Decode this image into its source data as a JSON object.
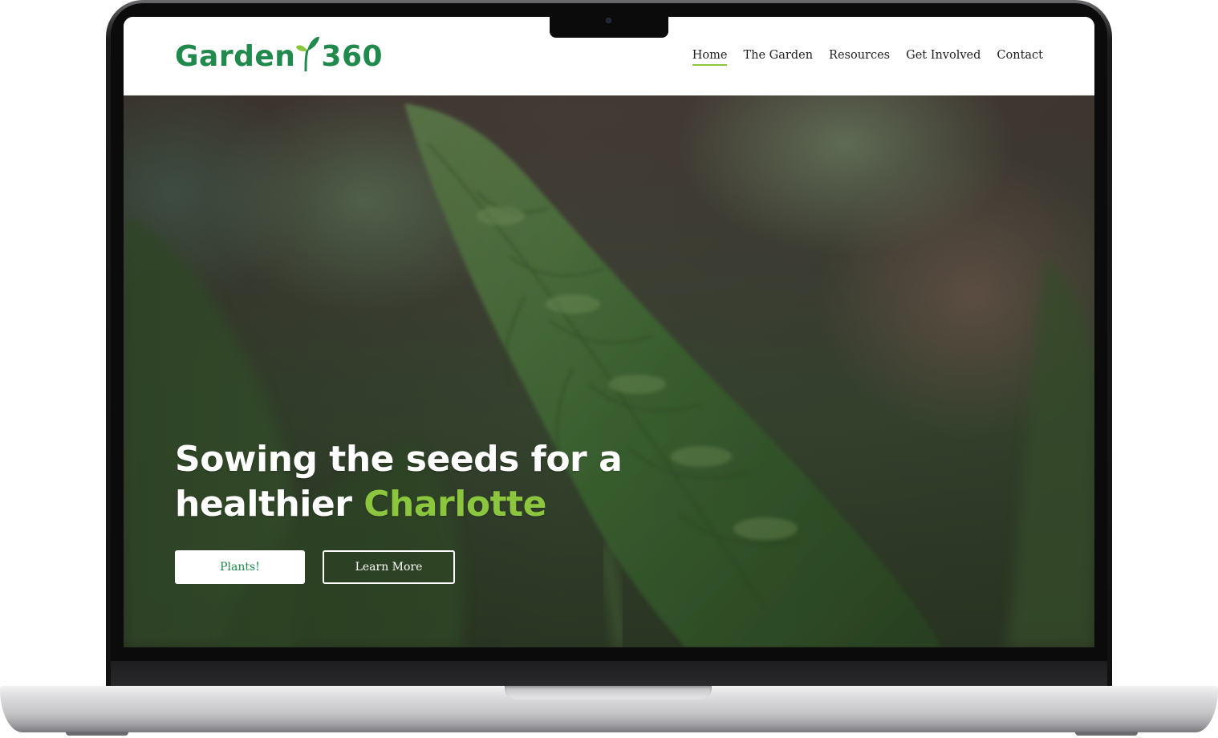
{
  "logo": {
    "text_left": "Garden",
    "text_right": "360",
    "icon": "sprout-icon",
    "color": "#1f8a4c"
  },
  "nav": {
    "items": [
      {
        "label": "Home",
        "active": true
      },
      {
        "label": "The Garden",
        "active": false
      },
      {
        "label": "Resources",
        "active": false
      },
      {
        "label": "Get Involved",
        "active": false
      },
      {
        "label": "Contact",
        "active": false
      }
    ]
  },
  "hero": {
    "title_line1": "Sowing the seeds for a",
    "title_line2_prefix": "healthier",
    "title_line2_accent": "Charlotte",
    "accent_color": "#8cc63f",
    "primary_button": "Plants!",
    "secondary_button": "Learn More"
  },
  "device": {
    "type": "laptop-mockup",
    "body_color": "#c4c4c7",
    "bezel_color": "#0b0b0c"
  }
}
